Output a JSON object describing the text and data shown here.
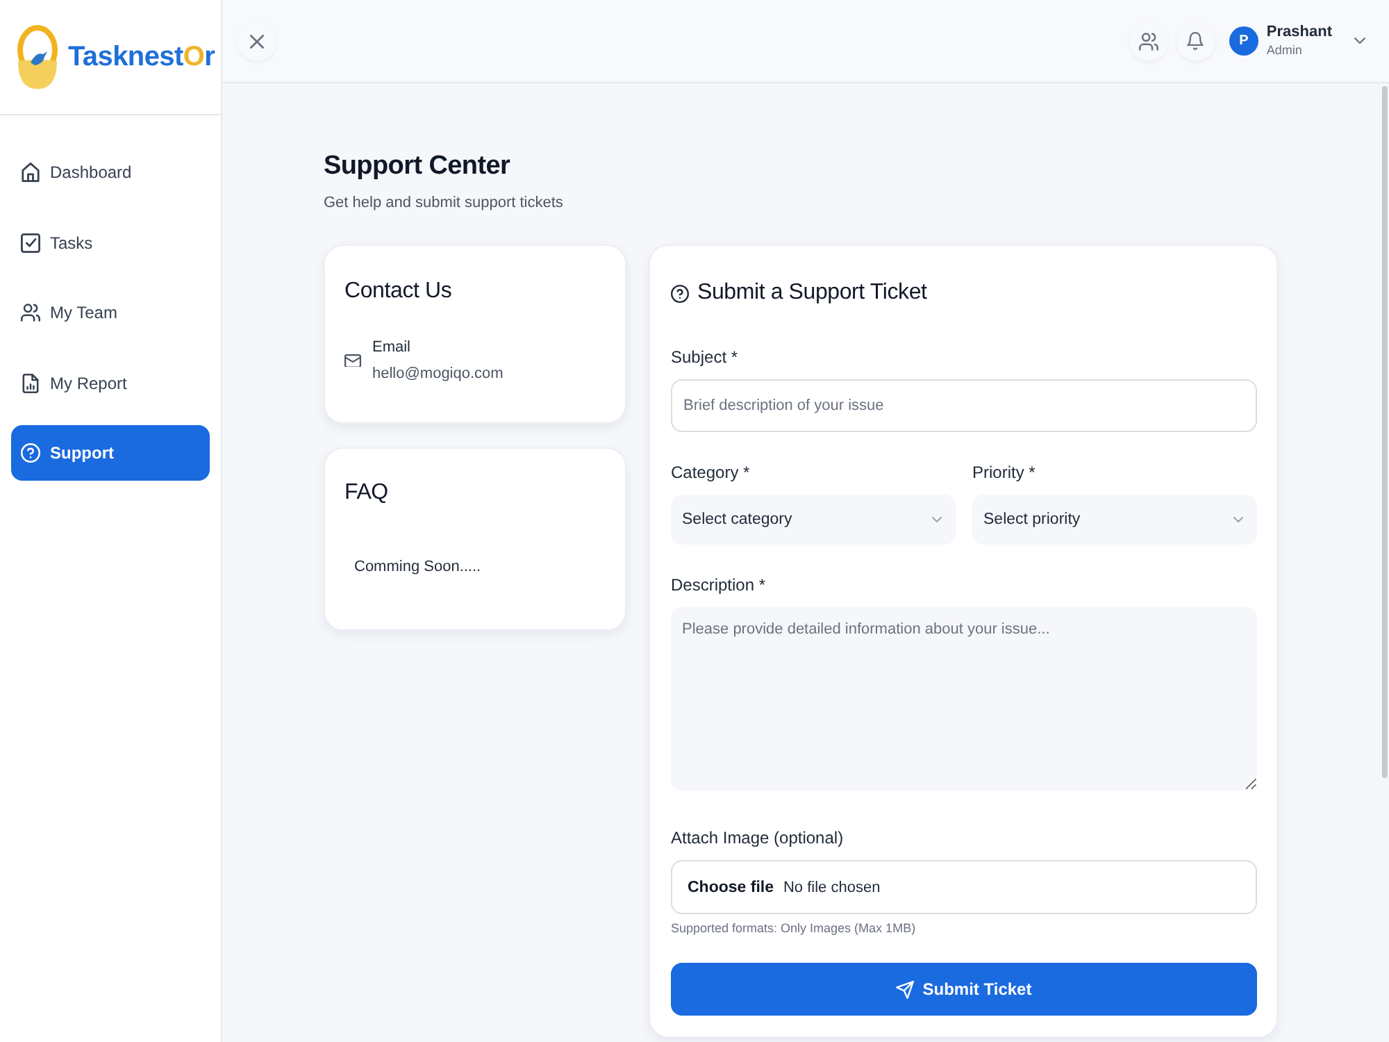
{
  "sidebar": {
    "logo": {
      "text_parts": [
        "Tasknest",
        "O",
        "r"
      ]
    },
    "items": [
      {
        "label": "Dashboard",
        "selected": false
      },
      {
        "label": "Tasks",
        "selected": false
      },
      {
        "label": "My Team",
        "selected": false
      },
      {
        "label": "My Report",
        "selected": false
      },
      {
        "label": "Support",
        "selected": true
      }
    ]
  },
  "topbar": {
    "user": {
      "initial": "P",
      "name": "Prashant",
      "role": "Admin"
    }
  },
  "page": {
    "title": "Support Center",
    "subtitle": "Get help and submit support tickets"
  },
  "contact_card": {
    "title": "Contact Us",
    "items": [
      {
        "label": "Email",
        "value": "hello@mogiqo.com"
      }
    ]
  },
  "faq_card": {
    "title": "FAQ",
    "text": "Comming Soon....."
  },
  "ticket_form": {
    "title": "Submit a Support Ticket",
    "subject": {
      "label": "Subject *",
      "placeholder": "Brief description of your issue"
    },
    "category": {
      "label": "Category *",
      "value": "Select category"
    },
    "priority": {
      "label": "Priority *",
      "value": "Select priority"
    },
    "description": {
      "label": "Description *",
      "placeholder": "Please provide detailed information about your issue..."
    },
    "attachment": {
      "label": "Attach Image (optional)",
      "button": "Choose file",
      "status": "No file chosen",
      "hint": "Supported formats: Only Images (Max 1MB)"
    },
    "submit": "Submit Ticket"
  }
}
